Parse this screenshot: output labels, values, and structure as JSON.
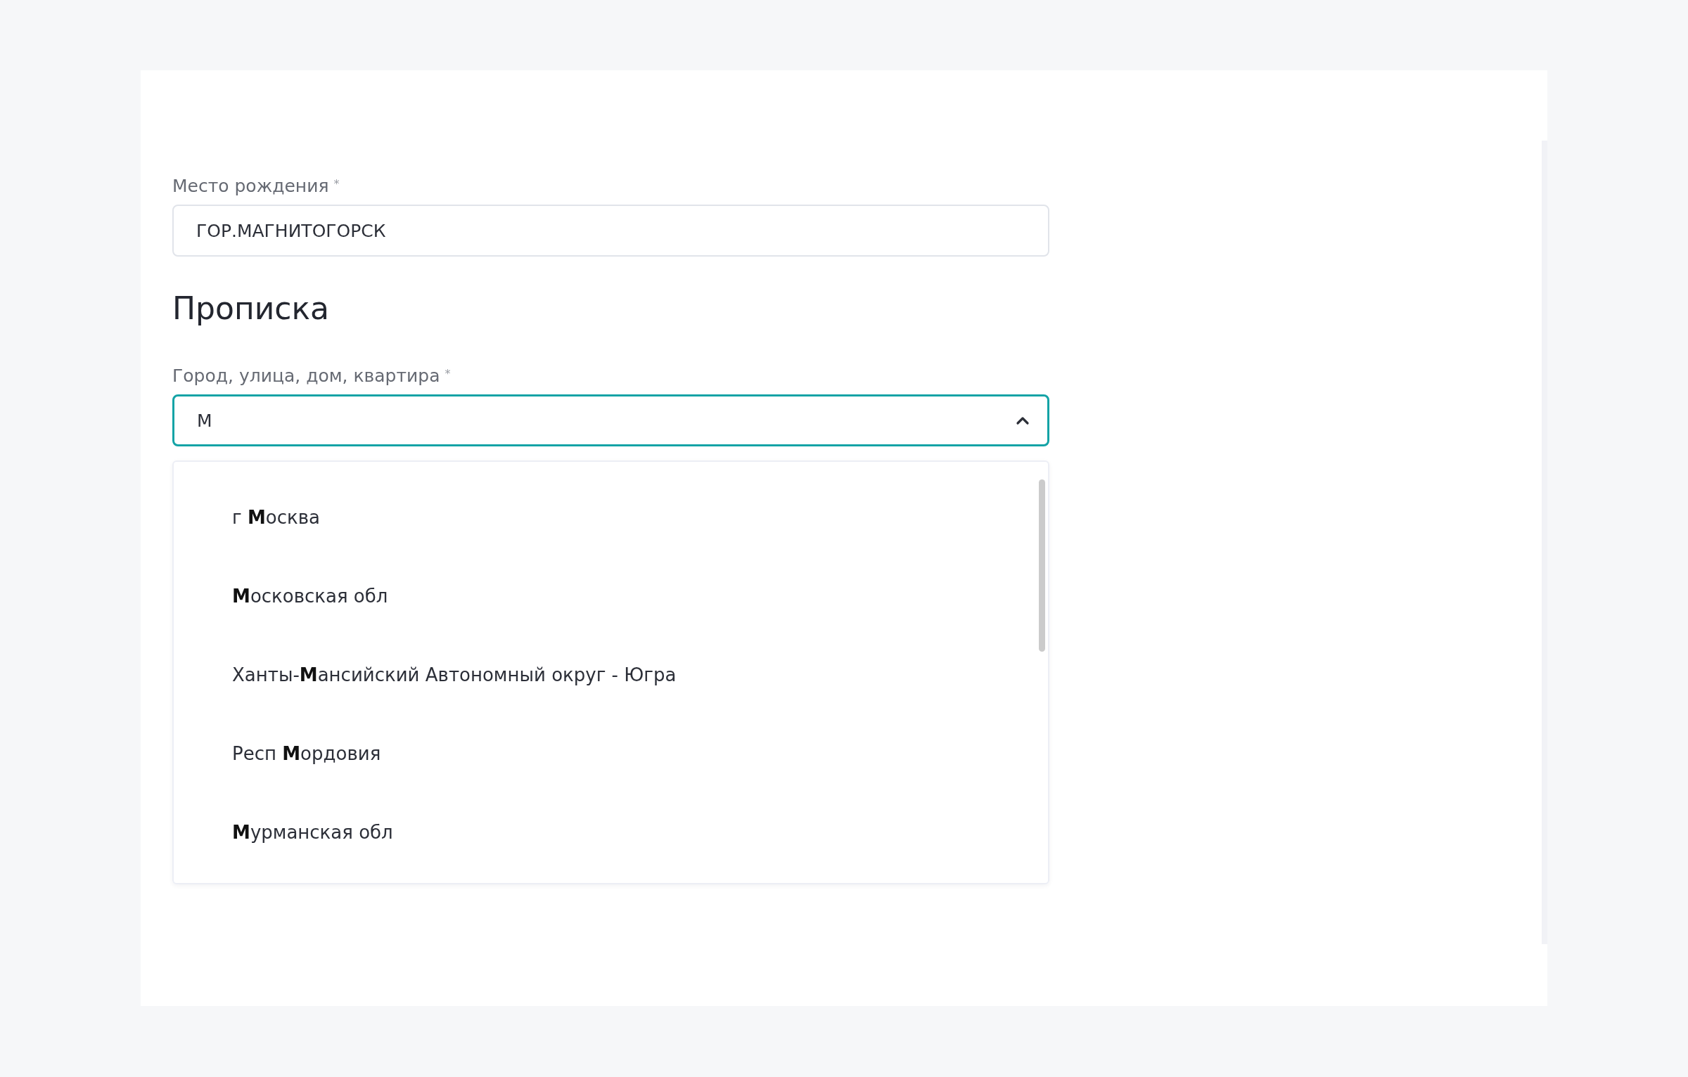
{
  "birthplace": {
    "label": "Место рождения",
    "required_mark": "*",
    "value": "ГОР.МАГНИТОГОРСК"
  },
  "registration": {
    "heading": "Прописка",
    "address": {
      "label": "Город, улица, дом, квартира",
      "required_mark": "*",
      "value": "М",
      "focused": true,
      "expanded": true
    },
    "suggestions": [
      {
        "text": "г **М**осква"
      },
      {
        "text": "**М**осковская обл"
      },
      {
        "text": "Ханты-**М**ансийский Автономный округ - Югра"
      },
      {
        "text": "Респ **М**ордовия"
      },
      {
        "text": "**М**урманская обл"
      }
    ]
  }
}
